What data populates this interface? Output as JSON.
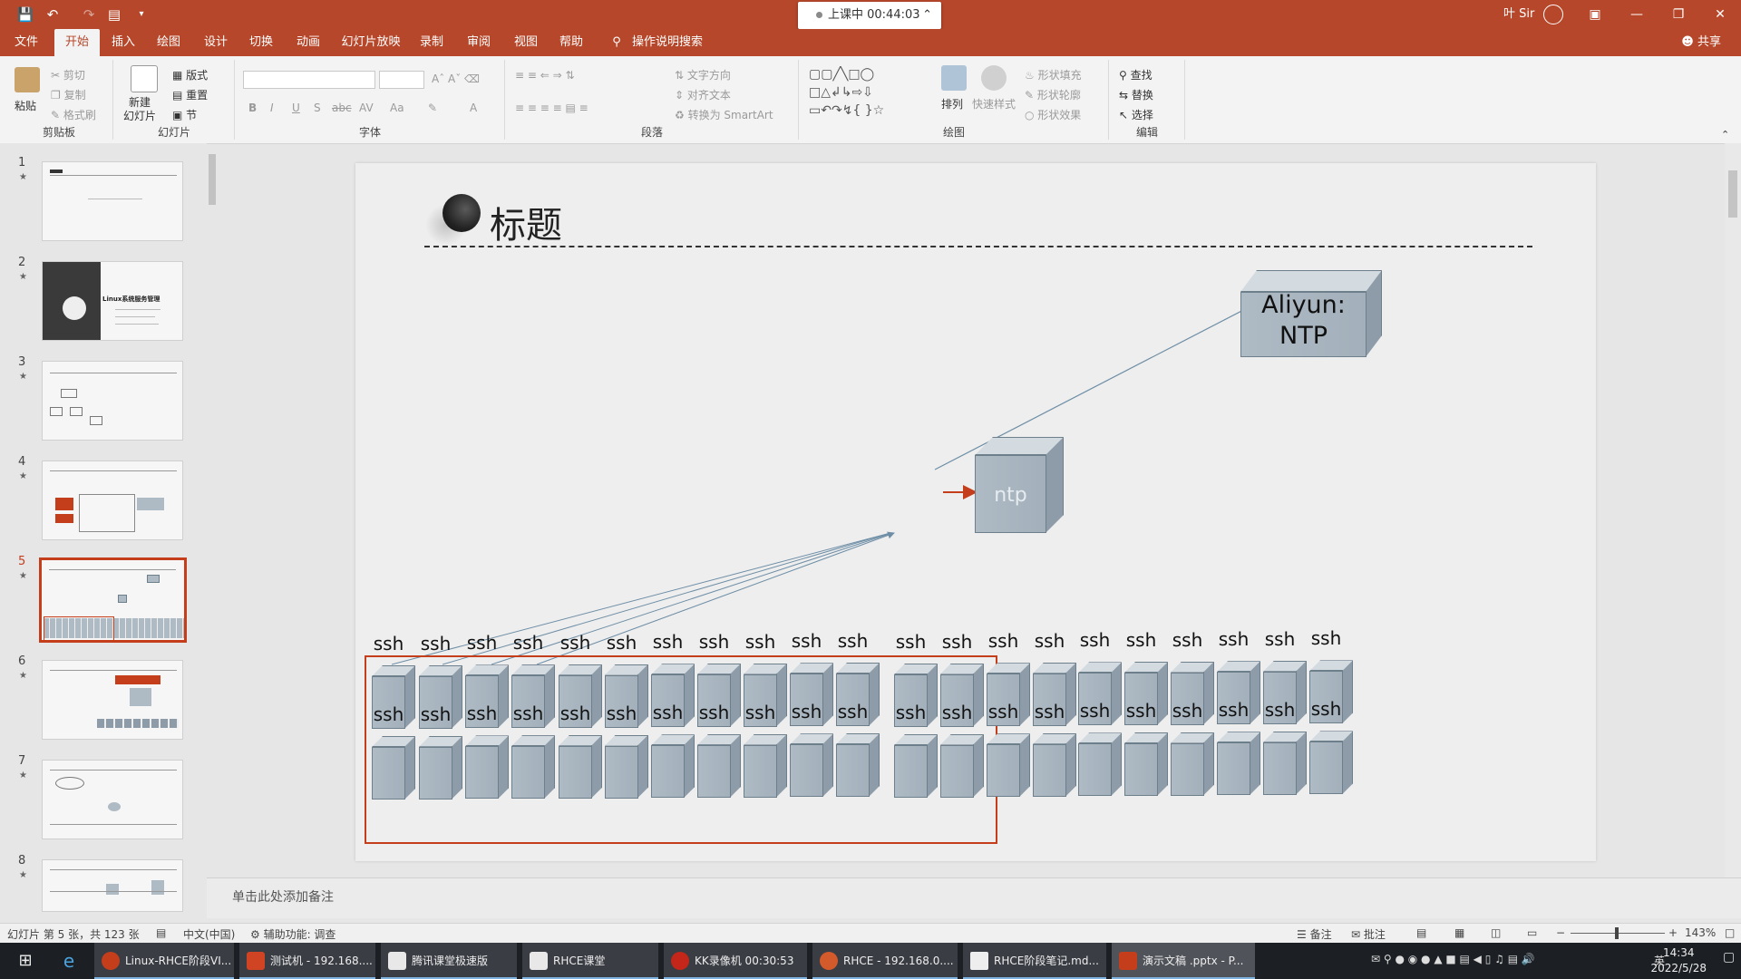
{
  "titlebar": {
    "recording_status": "上课中 00:44:03",
    "username": "叶 Sir"
  },
  "menu": {
    "tabs": [
      "文件",
      "开始",
      "插入",
      "绘图",
      "设计",
      "切换",
      "动画",
      "幻灯片放映",
      "录制",
      "审阅",
      "视图",
      "帮助"
    ],
    "active_tab": "开始",
    "tell_me": "操作说明搜索",
    "share": "共享"
  },
  "ribbon": {
    "clipboard": {
      "label": "剪贴板",
      "paste": "粘贴",
      "cut": "剪切",
      "copy": "复制",
      "format_painter": "格式刷"
    },
    "slides": {
      "label": "幻灯片",
      "new_slide": "新建\n幻灯片",
      "layout": "版式",
      "reset": "重置",
      "section": "节"
    },
    "font": {
      "label": "字体",
      "buttons": [
        "B",
        "I",
        "U",
        "S",
        "abc",
        "AV",
        "Aa",
        "A"
      ]
    },
    "paragraph": {
      "label": "段落",
      "text_direction": "文字方向",
      "align_text": "对齐文本",
      "convert_smartart": "转换为 SmartArt"
    },
    "drawing": {
      "label": "绘图",
      "arrange": "排列",
      "quick_styles": "快速样式",
      "shape_fill": "形状填充",
      "shape_outline": "形状轮廓",
      "shape_effects": "形状效果"
    },
    "editing": {
      "label": "编辑",
      "find": "查找",
      "replace": "替换",
      "select": "选择"
    }
  },
  "thumbnails": {
    "numbers": [
      "1",
      "2",
      "3",
      "4",
      "5",
      "6",
      "7",
      "8"
    ],
    "active": "5",
    "slide2_text": "Linux系统服务管理"
  },
  "slide": {
    "title": "标题",
    "aliyun_label_line1": "Aliyun:",
    "aliyun_label_line2": "NTP",
    "ntp_label": "ntp",
    "ssh_label": "ssh"
  },
  "notes_placeholder": "单击此处添加备注",
  "statusbar": {
    "slide_info": "幻灯片 第 5 张，共 123 张",
    "language": "中文(中国)",
    "accessibility": "辅助功能: 调查",
    "notes": "备注",
    "comments": "批注",
    "zoom": "143%"
  },
  "taskbar": {
    "apps": [
      "Linux-RHCE阶段VI...",
      "测试机 - 192.168....",
      "腾讯课堂极速版",
      "RHCE课堂",
      "KK录像机 00:30:53",
      "RHCE - 192.168.0....",
      "RHCE阶段笔记.md...",
      "演示文稿 .pptx - P..."
    ],
    "ime": "英",
    "time": "14:34",
    "date": "2022/5/28"
  },
  "colors": {
    "accent": "#b7472a",
    "highlight": "#c43e1c",
    "cube": "#a9b6c1"
  }
}
